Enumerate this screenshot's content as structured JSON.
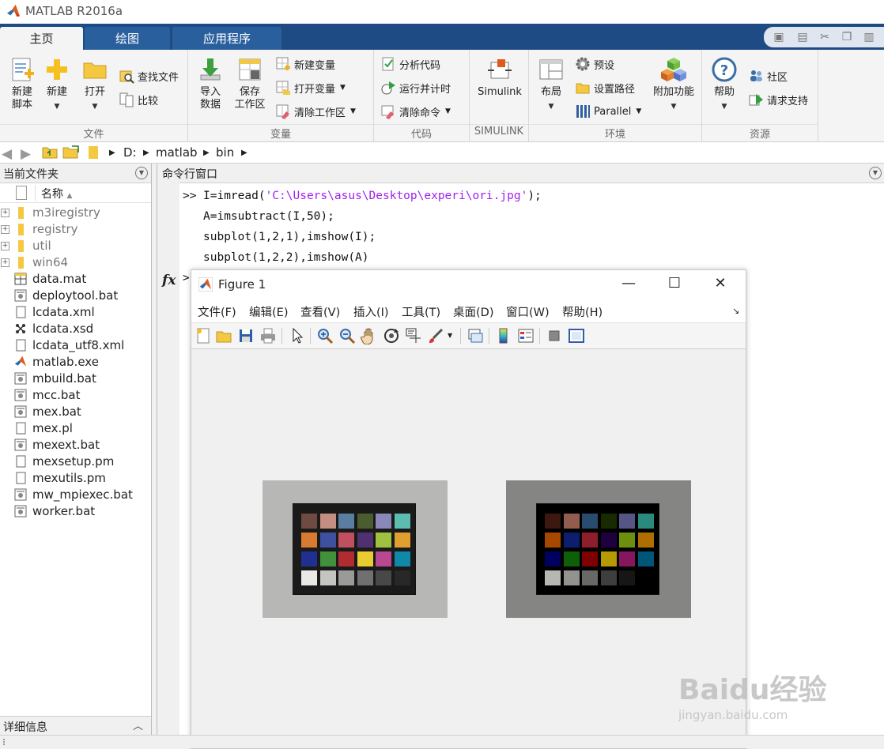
{
  "app": {
    "title": "MATLAB R2016a"
  },
  "tabs": [
    {
      "label": "主页"
    },
    {
      "label": "绘图"
    },
    {
      "label": "应用程序"
    }
  ],
  "ribbon": {
    "file": {
      "title": "文件",
      "new_script": "新建\n脚本",
      "new": "新建",
      "open": "打开",
      "find_files": "查找文件",
      "compare": "比较"
    },
    "variable": {
      "title": "变量",
      "import": "导入\n数据",
      "save_ws": "保存\n工作区",
      "new_var": "新建变量",
      "open_var": "打开变量",
      "clear_ws": "清除工作区"
    },
    "code": {
      "title": "代码",
      "analyze": "分析代码",
      "run_time": "运行并计时",
      "clear_cmd": "清除命令"
    },
    "simulink": {
      "title": "SIMULINK",
      "label": "Simulink"
    },
    "environment": {
      "title": "环境",
      "layout": "布局",
      "prefs": "预设",
      "set_path": "设置路径",
      "parallel": "Parallel",
      "addons": "附加功能"
    },
    "resources": {
      "title": "资源",
      "help": "帮助",
      "community": "社区",
      "support": "请求支持"
    }
  },
  "address": {
    "segments": [
      "D:",
      "matlab",
      "bin"
    ]
  },
  "current_folder": {
    "title": "当前文件夹",
    "column_name": "名称",
    "items": [
      {
        "name": "m3iregistry",
        "type": "folder"
      },
      {
        "name": "registry",
        "type": "folder"
      },
      {
        "name": "util",
        "type": "folder"
      },
      {
        "name": "win64",
        "type": "folder"
      },
      {
        "name": "data.mat",
        "type": "mat"
      },
      {
        "name": "deploytool.bat",
        "type": "bat"
      },
      {
        "name": "lcdata.xml",
        "type": "doc"
      },
      {
        "name": "lcdata.xsd",
        "type": "xsd"
      },
      {
        "name": "lcdata_utf8.xml",
        "type": "doc"
      },
      {
        "name": "matlab.exe",
        "type": "exe"
      },
      {
        "name": "mbuild.bat",
        "type": "bat"
      },
      {
        "name": "mcc.bat",
        "type": "bat"
      },
      {
        "name": "mex.bat",
        "type": "bat"
      },
      {
        "name": "mex.pl",
        "type": "doc"
      },
      {
        "name": "mexext.bat",
        "type": "bat"
      },
      {
        "name": "mexsetup.pm",
        "type": "doc"
      },
      {
        "name": "mexutils.pm",
        "type": "doc"
      },
      {
        "name": "mw_mpiexec.bat",
        "type": "bat"
      },
      {
        "name": "worker.bat",
        "type": "bat"
      }
    ],
    "details_label": "详细信息"
  },
  "command_window": {
    "title": "命令行窗口",
    "prompt": ">>",
    "line1_pre": "I=imread(",
    "line1_str": "'C:\\Users\\asus\\Desktop\\experi\\ori.jpg'",
    "line1_post": ");",
    "line2": "A=imsubtract(I,50);",
    "line3": "subplot(1,2,1),imshow(I);",
    "line4": "subplot(1,2,2),imshow(A)",
    "fx": "fx",
    "prompt2": ">"
  },
  "figure": {
    "title": "Figure 1",
    "menu": [
      "文件(F)",
      "编辑(E)",
      "查看(V)",
      "插入(I)",
      "工具(T)",
      "桌面(D)",
      "窗口(W)",
      "帮助(H)"
    ],
    "toolbar_icons": [
      "new-figure-icon",
      "open-icon",
      "save-icon",
      "print-icon",
      "pointer-icon",
      "zoom-in-icon",
      "zoom-out-icon",
      "pan-icon",
      "rotate-3d-icon",
      "data-cursor-icon",
      "brush-icon",
      "link-plot-icon",
      "colorbar-icon",
      "legend-icon",
      "hide-plot-tools-icon",
      "show-plot-tools-icon"
    ],
    "checker_colors_original": [
      "#6e4a40",
      "#c48f80",
      "#5a7ea0",
      "#4a5c30",
      "#8a88b8",
      "#5cbcb0",
      "#d87a30",
      "#4050a0",
      "#c05060",
      "#503070",
      "#a0c040",
      "#e0a030",
      "#203090",
      "#40903c",
      "#b02c30",
      "#e8cc30",
      "#b84890",
      "#1088a8",
      "#e8e8e4",
      "#c4c4c0",
      "#9a9a98",
      "#707070",
      "#484848",
      "#282828"
    ],
    "checker_colors_subtracted": [
      "#3c1810",
      "#925d4e",
      "#284c6e",
      "#182a00",
      "#565686",
      "#2a8a7e",
      "#a64800",
      "#0e1e6e",
      "#8e1e2e",
      "#1e003e",
      "#6e8e0e",
      "#ae6e00",
      "#00005e",
      "#0e5e0a",
      "#7e0000",
      "#b69a00",
      "#86165e",
      "#005676",
      "#b6b6b2",
      "#92928e",
      "#686866",
      "#3e3e3e",
      "#161616",
      "#000000"
    ]
  },
  "watermark": {
    "brand": "Baidu经验",
    "url": "jingyan.baidu.com"
  }
}
